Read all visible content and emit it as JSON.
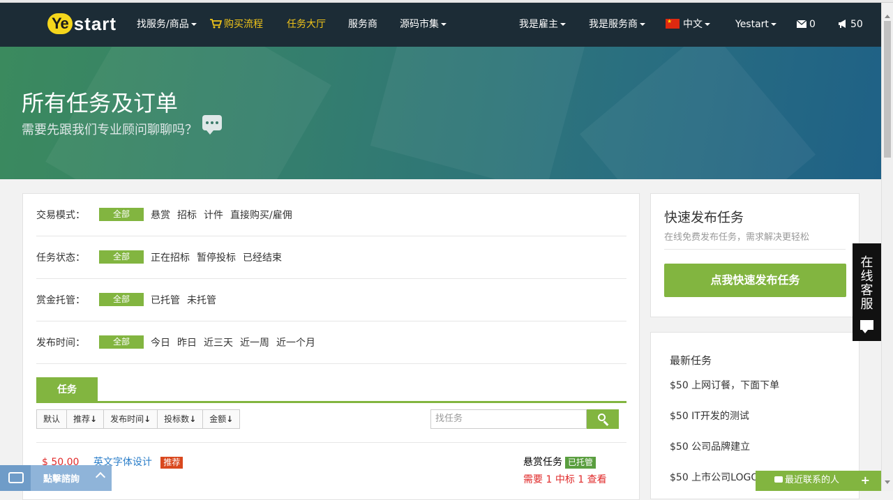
{
  "brand": {
    "logo_ye": "Ye",
    "logo_start": "start"
  },
  "nav": {
    "find_service": "找服务/商品",
    "buy_flow": "购买流程",
    "task_hall": "任务大厅",
    "providers": "服务商",
    "code_market": "源码市集",
    "employer": "我是雇主",
    "provider_me": "我是服务商",
    "language": "中文",
    "user": "Yestart",
    "mail_count": "0",
    "notice_count": "50"
  },
  "hero": {
    "title": "所有任务及订单",
    "subtitle": "需要先跟我们专业顾问聊聊吗？"
  },
  "filters": [
    {
      "label": "交易模式：",
      "all": "全部",
      "options": [
        "悬赏",
        "招标",
        "计件",
        "直接购买/雇佣"
      ]
    },
    {
      "label": "任务状态：",
      "all": "全部",
      "options": [
        "正在招标",
        "暂停投标",
        "已经结束"
      ]
    },
    {
      "label": "赏金托管：",
      "all": "全部",
      "options": [
        "已托管",
        "未托管"
      ]
    },
    {
      "label": "发布时间：",
      "all": "全部",
      "options": [
        "今日",
        "昨日",
        "近三天",
        "近一周",
        "近一个月"
      ]
    }
  ],
  "tabs": {
    "task": "任务"
  },
  "sort": {
    "default": "默认",
    "recommend": "推荐",
    "publish_time": "发布时间",
    "bids": "投标数",
    "amount": "金额"
  },
  "search": {
    "placeholder": "找任务"
  },
  "task": {
    "price": "$ 50.00",
    "title": "英文字体设计",
    "badge": "推荐",
    "type": "悬赏任务",
    "trust": "已托管",
    "need_label": "需要",
    "need": "1",
    "won_label": "中标",
    "won": "1",
    "view": "查看"
  },
  "quick": {
    "title": "快速发布任务",
    "subtitle": "在线免费发布任务，需求解决更轻松",
    "button": "点我快速发布任务"
  },
  "latest": {
    "title": "最新任务",
    "items": [
      "$50 上网订餐，下面下单",
      "$50 IT开发的测试",
      "$50 公司品牌建立",
      "$50 上市公司LOGO"
    ]
  },
  "online_service": "在线客服",
  "chat_widget": {
    "label": "點擊諮詢"
  },
  "recent_contacts": "最近联系的人",
  "colors": {
    "accent": "#82b540",
    "nav_bg": "#1c2c36",
    "highlight": "#f0c419"
  }
}
